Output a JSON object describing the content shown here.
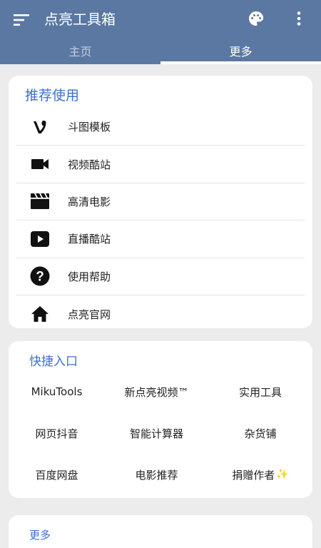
{
  "app": {
    "title": "点亮工具箱"
  },
  "tabs": [
    {
      "label": "主页"
    },
    {
      "label": "更多"
    }
  ],
  "recommend": {
    "title": "推荐使用",
    "items": [
      {
        "label": "斗图模板",
        "icon": "vine-icon"
      },
      {
        "label": "视频酷站",
        "icon": "videocam-icon"
      },
      {
        "label": "高清电影",
        "icon": "clapperboard-icon"
      },
      {
        "label": "直播酷站",
        "icon": "play-button-icon"
      },
      {
        "label": "使用帮助",
        "icon": "help-icon"
      },
      {
        "label": "点亮官网",
        "icon": "home-icon"
      }
    ]
  },
  "quick": {
    "title": "快捷入口",
    "items": [
      {
        "label": "MikuTools"
      },
      {
        "label": "新点亮视频™"
      },
      {
        "label": "实用工具"
      },
      {
        "label": "网页抖音"
      },
      {
        "label": "智能计算器"
      },
      {
        "label": "杂货铺"
      },
      {
        "label": "百度网盘"
      },
      {
        "label": "电影推荐"
      },
      {
        "label": "捐赠作者"
      }
    ],
    "sparkle": "✨"
  },
  "more": {
    "title": "更多"
  },
  "colors": {
    "appbar": "#5b78a2",
    "accent": "#3a6fd0",
    "background": "#ececec"
  }
}
